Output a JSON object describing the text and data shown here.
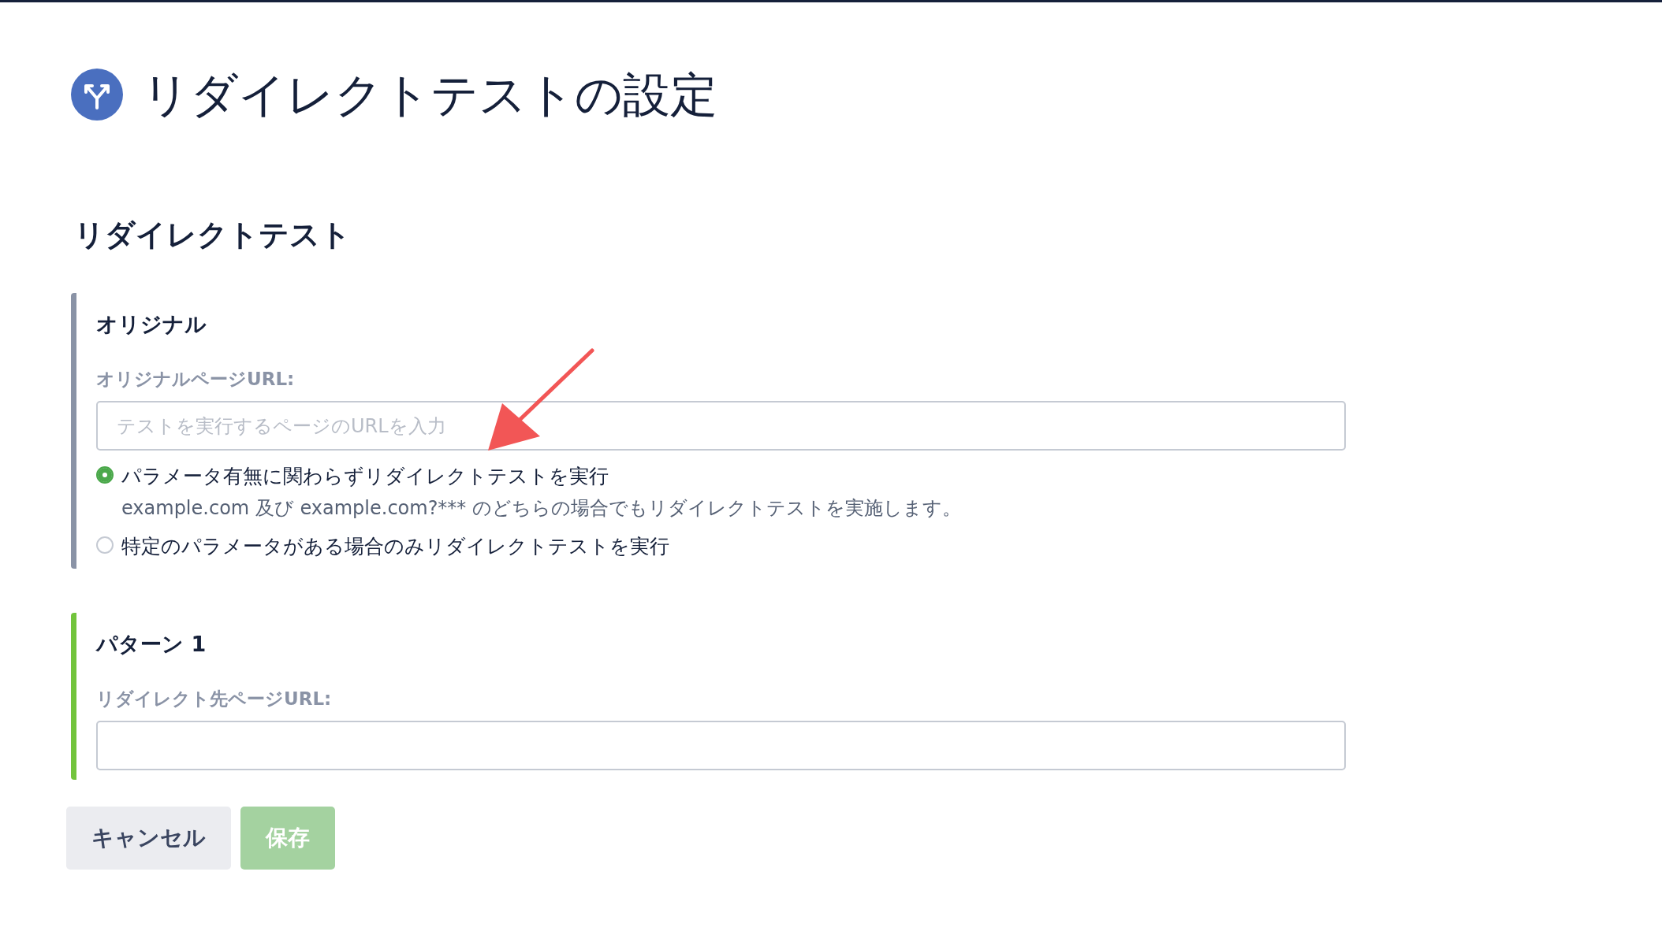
{
  "header": {
    "title": "リダイレクトテストの設定"
  },
  "section": {
    "title": "リダイレクトテスト"
  },
  "blocks": [
    {
      "kind": "original",
      "color": "#8a93a6",
      "heading": "オリジナル",
      "field": {
        "label": "オリジナルページURL:",
        "placeholder": "テストを実行するページのURLを入力"
      },
      "options": [
        {
          "label": "パラメータ有無に関わらずリダイレクトテストを実行",
          "description": "example.com 及び example.com?*** のどちらの場合でもリダイレクトテストを実施します。",
          "selected": true
        },
        {
          "label": "特定のパラメータがある場合のみリダイレクトテストを実行",
          "selected": false
        }
      ]
    },
    {
      "kind": "pattern",
      "color": "#72c43c",
      "heading": "パターン 1",
      "field": {
        "label": "リダイレクト先ページURL:"
      }
    }
  ],
  "buttons": [
    {
      "kind": "secondary",
      "label": "キャンセル",
      "disabled": false
    },
    {
      "kind": "primary",
      "label": "保存",
      "disabled": true
    }
  ]
}
